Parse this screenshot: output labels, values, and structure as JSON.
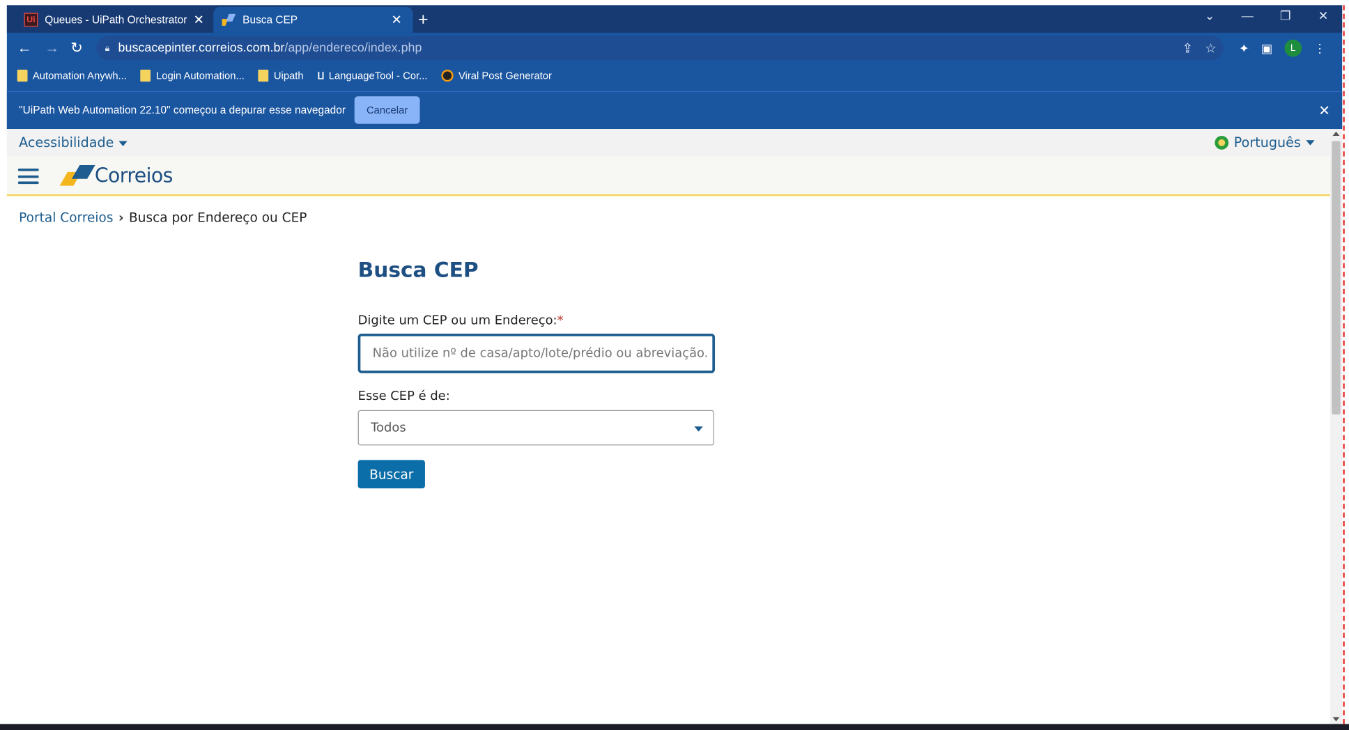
{
  "browser": {
    "tabs": [
      {
        "title": "Queues - UiPath Orchestrator",
        "favicon": "uipath-icon"
      },
      {
        "title": "Busca CEP",
        "favicon": "correios-icon"
      }
    ],
    "url_host": "buscacepinter.correios.com.br",
    "url_path": "/app/endereco/index.php",
    "profile_initial": "L",
    "bookmarks": [
      "Automation Anywh...",
      "Login Automation...",
      "Uipath",
      "LanguageTool - Cor...",
      "Viral Post Generator"
    ],
    "debug_message": "\"UiPath Web Automation 22.10\" começou a depurar esse navegador",
    "debug_cancel": "Cancelar"
  },
  "site": {
    "accessibility": "Acessibilidade",
    "language": "Português",
    "logo_text": "Correios",
    "breadcrumb": {
      "link": "Portal Correios",
      "separator": "›",
      "current": "Busca por Endereço ou CEP"
    }
  },
  "form": {
    "title": "Busca CEP",
    "cep_label": "Digite um CEP ou um Endereço:",
    "required_mark": "*",
    "cep_placeholder": "Não utilize nº de casa/apto/lote/prédio ou abreviação.",
    "type_label": "Esse CEP é de:",
    "type_value": "Todos",
    "submit": "Buscar"
  },
  "colors": {
    "chrome_blue": "#1a55a0",
    "brand_blue": "#1d5d8f",
    "brand_yellow": "#f4d35e",
    "button_blue": "#0b6ea8"
  }
}
